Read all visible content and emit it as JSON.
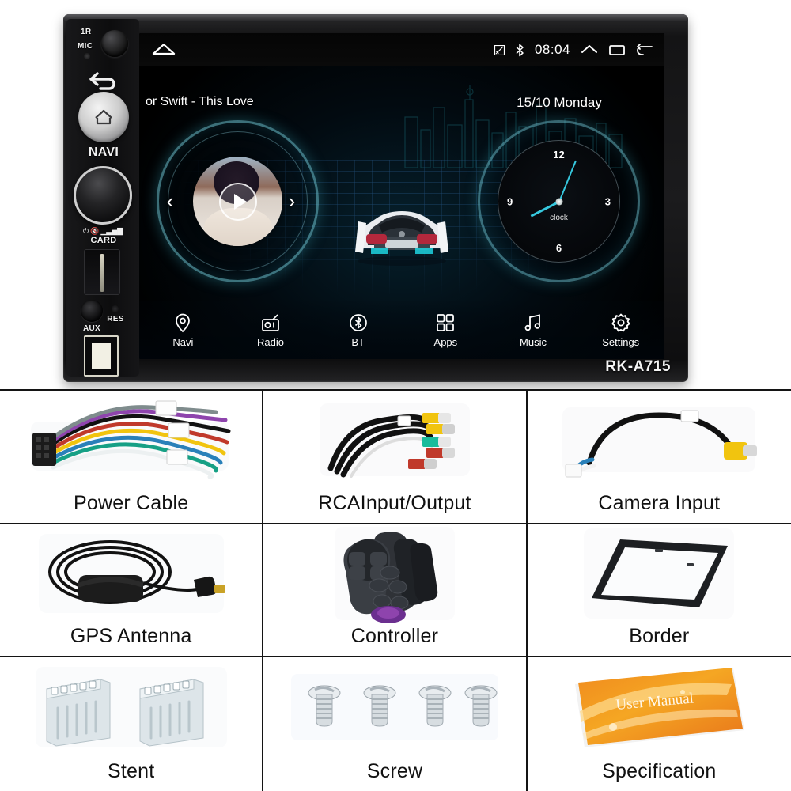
{
  "product": {
    "model_badge": "RK-A715",
    "left_panel": {
      "ir_label": "1R",
      "mic_label": "MIC",
      "navi_label": "NAVI",
      "card_label": "CARD",
      "aux_label": "AUX",
      "res_label": "RES",
      "knob_icons": "power-mute-volume-icons",
      "mic_knob": "microphone-knob",
      "back_button": "back-arrow-button",
      "home_button": "home-button",
      "volume_knob": "volume-knob",
      "card_slot": "sd-card-slot",
      "aux_jack": "aux-jack",
      "reset_button": "reset-pinhole",
      "usb_port": "usb-port"
    },
    "screen": {
      "status_bar": {
        "home_icon": "home-icon",
        "cast_icon": "screen-cast-icon",
        "bluetooth_icon": "bluetooth-icon",
        "time": "08:04",
        "chevron_up_icon": "chevron-up-icon",
        "recents_icon": "recent-apps-icon",
        "back_icon": "back-arrow-icon"
      },
      "media": {
        "song_title": "or Swift - This Love",
        "play_icon": "play-icon",
        "prev_icon": "previous-track-icon",
        "next_icon": "next-track-icon",
        "album_art": "album-art-thumbnail"
      },
      "clock": {
        "date": "15/10  Monday",
        "face_label": "clock",
        "numerals": {
          "twelve": "12",
          "three": "3",
          "six": "6",
          "nine": "9"
        }
      },
      "wallpaper": {
        "car_graphic": "sports-car-graphic",
        "skyline_graphic": "city-skyline-graphic",
        "grid_graphic": "perspective-grid-graphic"
      },
      "nav_items": [
        {
          "label": "Navi",
          "icon": "location-pin-icon"
        },
        {
          "label": "Radio",
          "icon": "radio-icon"
        },
        {
          "label": "BT",
          "icon": "bluetooth-icon"
        },
        {
          "label": "Apps",
          "icon": "grid-apps-icon"
        },
        {
          "label": "Music",
          "icon": "music-note-icon"
        },
        {
          "label": "Settings",
          "icon": "gear-icon"
        }
      ]
    }
  },
  "accessories": [
    {
      "label": "Power Cable",
      "art": "wiring-harness-photo"
    },
    {
      "label": "RCAInput/Output",
      "art": "rca-cable-photo"
    },
    {
      "label": "Camera Input",
      "art": "camera-input-cable-photo"
    },
    {
      "label": "GPS Antenna",
      "art": "gps-antenna-photo"
    },
    {
      "label": "Controller",
      "art": "steering-wheel-remote-photo"
    },
    {
      "label": "Border",
      "art": "mounting-border-frame-photo"
    },
    {
      "label": "Stent",
      "art": "mounting-brackets-photo"
    },
    {
      "label": "Screw",
      "art": "screws-photo"
    },
    {
      "label": "Specification",
      "art": "user-manual-photo"
    }
  ],
  "manual_cover_text": "User Manual",
  "colors": {
    "accent_cyan": "#36c8de",
    "chassis_black": "#141415",
    "grid_blue": "#285a8c"
  }
}
